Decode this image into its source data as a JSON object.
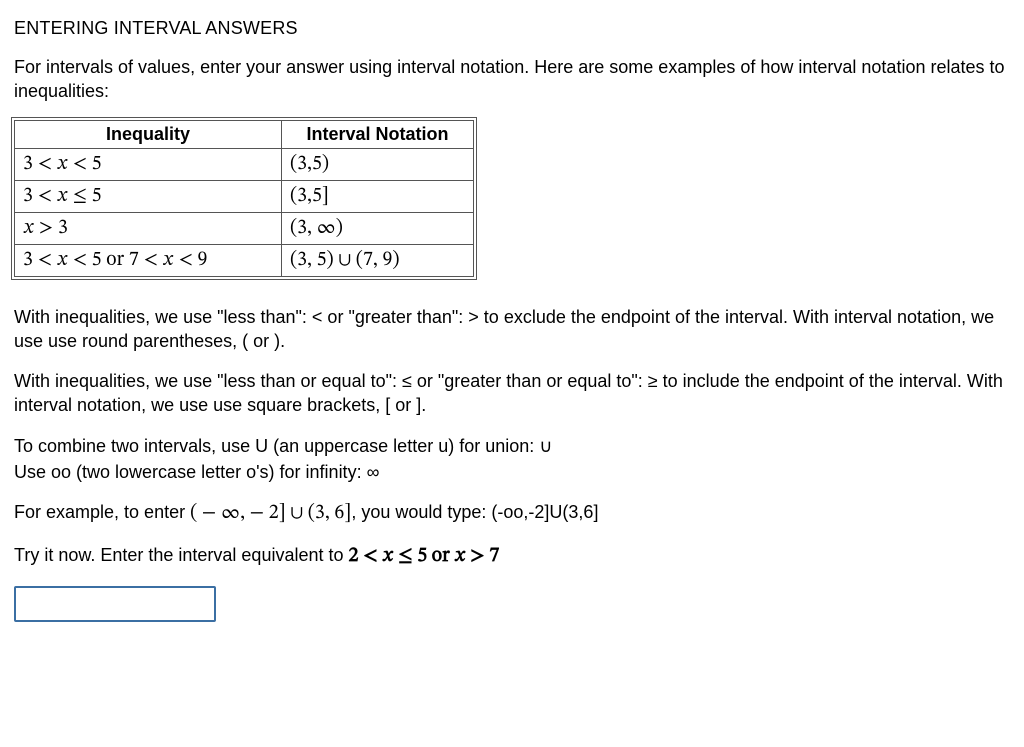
{
  "title": "ENTERING INTERVAL ANSWERS",
  "intro": "For intervals of values, enter your answer using interval notation. Here are some examples of how interval notation relates to inequalities:",
  "table": {
    "headers": [
      "Inequality",
      "Interval Notation"
    ],
    "rows": [
      {
        "ineq": "3 < 𝑥 < 5",
        "interval": "(3,5)"
      },
      {
        "ineq": "3 < 𝑥 ≤ 5",
        "interval": "(3,5]"
      },
      {
        "ineq": "𝑥 > 3",
        "interval": "(3, ∞)"
      },
      {
        "ineq": "3 < 𝑥 < 5 or 7 < 𝑥 < 9",
        "interval": "(3, 5) ∪ (7, 9)"
      }
    ]
  },
  "para_exclude": "With inequalities, we use \"less than\": < or \"greater than\": > to exclude the endpoint of the interval. With interval notation, we use use round parentheses, ( or ).",
  "para_include": "With inequalities, we use \"less than or equal to\": ≤ or \"greater than or equal to\": ≥ to include the endpoint of the interval. With interval notation, we use use square brackets, [ or ].",
  "para_union_1": "To combine two intervals, use U (an uppercase letter u) for union:  ∪",
  "para_union_2": "Use oo (two lowercase letter o's) for infinity: ∞",
  "example_prefix": "For example, to enter ",
  "example_math": "( − ∞,  − 2] ∪ (3, 6]",
  "example_suffix": ", you would type: (-oo,-2]U(3,6]",
  "try_prefix": "Try it now. Enter the interval equivalent to ",
  "try_math": "2 < 𝑥 ≤ 5 or 𝑥 > 7",
  "answer_value": ""
}
